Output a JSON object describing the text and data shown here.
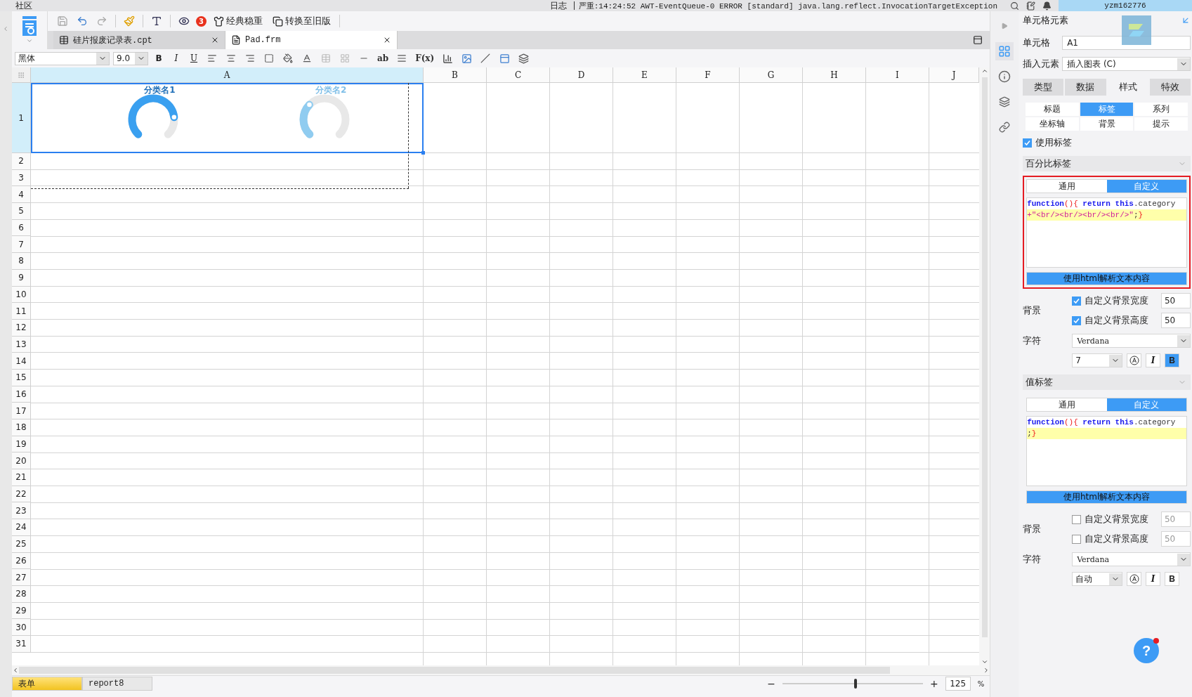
{
  "top_bar": {
    "menu": "社区",
    "log_label": "日志",
    "log_message": "严重:14:24:52 AWT-EventQueue-0 ERROR [standard] java.lang.reflect.InvocationTargetException",
    "user": "yzm162776"
  },
  "toolbar": {
    "notification_count": "3",
    "buttons": [
      {
        "label": "经典稳重"
      },
      {
        "label": "转换至旧版"
      }
    ]
  },
  "file_tabs": [
    {
      "name": "硅片报废记录表.cpt",
      "selected": false
    },
    {
      "name": "Pad.frm",
      "selected": true
    }
  ],
  "format_bar": {
    "font": "黑体",
    "size": "9.0",
    "style_buttons": [
      {
        "label": "B",
        "kind": "bold"
      },
      {
        "label": "I",
        "kind": "italic"
      },
      {
        "label": "U",
        "kind": "underline"
      }
    ],
    "insert_buttons": [
      {
        "label": "ab"
      },
      {
        "label": "F(x)"
      }
    ]
  },
  "grid": {
    "columns": [
      {
        "label": "A",
        "selected": true
      },
      {
        "label": "B",
        "selected": false
      },
      {
        "label": "C",
        "selected": false
      },
      {
        "label": "D",
        "selected": false
      },
      {
        "label": "E",
        "selected": false
      },
      {
        "label": "F",
        "selected": false
      },
      {
        "label": "G",
        "selected": false
      },
      {
        "label": "H",
        "selected": false
      },
      {
        "label": "I",
        "selected": false
      },
      {
        "label": "J",
        "selected": false
      }
    ],
    "rows": [
      {
        "label": "1",
        "selected": true
      },
      {
        "label": "2",
        "selected": false
      },
      {
        "label": "3",
        "selected": false
      },
      {
        "label": "4",
        "selected": false
      },
      {
        "label": "5",
        "selected": false
      },
      {
        "label": "6",
        "selected": false
      },
      {
        "label": "7",
        "selected": false
      },
      {
        "label": "8",
        "selected": false
      },
      {
        "label": "9",
        "selected": false
      },
      {
        "label": "10",
        "selected": false
      },
      {
        "label": "11",
        "selected": false
      },
      {
        "label": "12",
        "selected": false
      },
      {
        "label": "13",
        "selected": false
      },
      {
        "label": "14",
        "selected": false
      },
      {
        "label": "15",
        "selected": false
      },
      {
        "label": "16",
        "selected": false
      },
      {
        "label": "17",
        "selected": false
      },
      {
        "label": "18",
        "selected": false
      },
      {
        "label": "19",
        "selected": false
      },
      {
        "label": "20",
        "selected": false
      },
      {
        "label": "21",
        "selected": false
      },
      {
        "label": "22",
        "selected": false
      },
      {
        "label": "23",
        "selected": false
      },
      {
        "label": "24",
        "selected": false
      },
      {
        "label": "25",
        "selected": false
      },
      {
        "label": "26",
        "selected": false
      },
      {
        "label": "27",
        "selected": false
      },
      {
        "label": "28",
        "selected": false
      },
      {
        "label": "29",
        "selected": false
      },
      {
        "label": "30",
        "selected": false
      },
      {
        "label": "31",
        "selected": false
      }
    ],
    "gauges": [
      {
        "category": "分类名1"
      },
      {
        "category": "分类名2"
      }
    ]
  },
  "bottom_bar": {
    "sheets": [
      {
        "name": "表单",
        "selected": true
      },
      {
        "name": "report8",
        "selected": false
      }
    ],
    "zoom_minus": "−",
    "zoom_plus": "+",
    "zoom_slider": {
      "level": 0.52
    },
    "zoom_value": "125",
    "zoom_unit": "%"
  },
  "right_panel": {
    "title": "单元格元素",
    "cell_label": "单元格",
    "cell_value": "A1",
    "insert_label": "插入元素",
    "insert_value": "插入图表 (C)",
    "main_tabs": [
      {
        "label": "类型",
        "selected": false
      },
      {
        "label": "数据",
        "selected": false
      },
      {
        "label": "样式",
        "selected": true
      },
      {
        "label": "特效",
        "selected": false
      }
    ],
    "sub_tabs": [
      {
        "label": "标题",
        "selected": false
      },
      {
        "label": "标签",
        "selected": true
      },
      {
        "label": "系列",
        "selected": false
      },
      {
        "label": "坐标轴",
        "selected": false
      },
      {
        "label": "背景",
        "selected": false
      },
      {
        "label": "提示",
        "selected": false
      }
    ],
    "use_label": {
      "label": "使用标签",
      "checked": true
    },
    "sections": [
      {
        "title": "百分比标签",
        "highlighted": true,
        "modes": [
          {
            "label": "通用",
            "selected": false
          },
          {
            "label": "自定义",
            "selected": true
          }
        ],
        "code": [
          {
            "current": false,
            "tokens": [
              {
                "kind": "keyword",
                "text": "function"
              },
              {
                "kind": "punct",
                "text": "(){"
              },
              {
                "kind": "keyword",
                "text": " return this"
              },
              {
                "kind": "plain",
                "text": ".category"
              }
            ]
          },
          {
            "current": true,
            "tokens": [
              {
                "kind": "string",
                "text": "+\"<br/><br/><br/><br/>\""
              },
              {
                "kind": "plain",
                "text": ";"
              },
              {
                "kind": "punct",
                "text": "}"
              }
            ]
          }
        ],
        "html_button": "使用html解析文本内容",
        "background_label": "背景",
        "bg_options": [
          {
            "label": "自定义背景宽度",
            "checked": true,
            "value": "50"
          },
          {
            "label": "自定义背景高度",
            "checked": true,
            "value": "50"
          }
        ],
        "font_label": "字符",
        "font": "Verdana",
        "size": "7",
        "italic_label": "I",
        "bold_label": "B",
        "bold": true
      },
      {
        "title": "值标签",
        "highlighted": false,
        "modes": [
          {
            "label": "通用",
            "selected": false
          },
          {
            "label": "自定义",
            "selected": true
          }
        ],
        "code": [
          {
            "current": false,
            "tokens": [
              {
                "kind": "keyword",
                "text": "function"
              },
              {
                "kind": "punct",
                "text": "(){"
              },
              {
                "kind": "keyword",
                "text": " return this"
              },
              {
                "kind": "plain",
                "text": ".category"
              }
            ]
          },
          {
            "current": true,
            "tokens": [
              {
                "kind": "plain",
                "text": ";"
              },
              {
                "kind": "punct",
                "text": "}"
              }
            ]
          }
        ],
        "html_button": "使用html解析文本内容",
        "background_label": "背景",
        "bg_options": [
          {
            "label": "自定义背景宽度",
            "checked": false,
            "value": "50"
          },
          {
            "label": "自定义背景高度",
            "checked": false,
            "value": "50"
          }
        ],
        "font_label": "字符",
        "font": "Verdana",
        "size": "自动",
        "italic_label": "I",
        "bold_label": "B",
        "bold": false
      }
    ],
    "help": "?"
  }
}
